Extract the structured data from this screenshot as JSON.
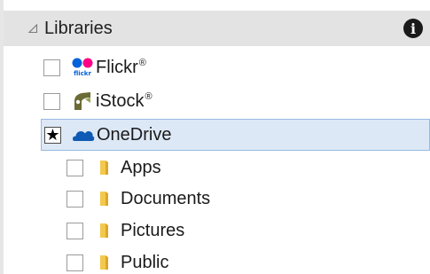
{
  "header": {
    "title": "Libraries",
    "info_glyph": "i"
  },
  "services": [
    {
      "label": "Flickr",
      "mark": "®",
      "icon": "flickr-icon",
      "checked": false,
      "glyph": ""
    },
    {
      "label": "iStock",
      "mark": "®",
      "icon": "istock-icon",
      "checked": false,
      "glyph": ""
    },
    {
      "label": "OneDrive",
      "mark": "",
      "icon": "onedrive-icon",
      "checked": true,
      "glyph": "★"
    }
  ],
  "folders": [
    {
      "label": "Apps",
      "icon": "folder-icon",
      "checked": false
    },
    {
      "label": "Documents",
      "icon": "folder-icon",
      "checked": false
    },
    {
      "label": "Pictures",
      "icon": "folder-icon",
      "checked": false
    },
    {
      "label": "Public",
      "icon": "folder-icon",
      "checked": false
    }
  ],
  "colors": {
    "header_bg": "#e3e3e3",
    "selected_bg": "#dde8f6",
    "selected_border": "#98b9e1",
    "onedrive_blue": "#0f5ab4",
    "flickr_blue": "#0063dc",
    "flickr_pink": "#ff0084",
    "istock_green": "#7a7a3a",
    "folder_yellow": "#f2c94c"
  }
}
